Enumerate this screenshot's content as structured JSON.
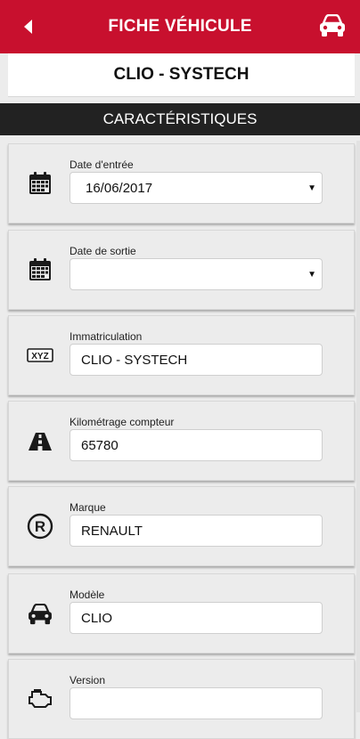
{
  "header": {
    "title": "FICHE VÉHICULE"
  },
  "vehicle_name": "CLIO - SYSTECH",
  "section_title": "CARACTÉRISTIQUES",
  "fields": {
    "date_entree": {
      "label": "Date d'entrée",
      "value": "16/06/2017",
      "icon": "calendar-icon"
    },
    "date_sortie": {
      "label": "Date de sortie",
      "value": "",
      "icon": "calendar-icon"
    },
    "immatriculation": {
      "label": "Immatriculation",
      "value": "CLIO - SYSTECH",
      "icon": "license-plate-icon",
      "icon_text": "XYZ"
    },
    "kilometrage": {
      "label": "Kilométrage compteur",
      "value": "65780",
      "icon": "road-icon"
    },
    "marque": {
      "label": "Marque",
      "value": "RENAULT",
      "icon": "registered-trademark-icon",
      "icon_text": "R"
    },
    "modele": {
      "label": "Modèle",
      "value": "CLIO",
      "icon": "car-icon"
    },
    "version": {
      "label": "Version",
      "value": "",
      "icon": "engine-icon"
    }
  },
  "colors": {
    "header_red": "#c8102e",
    "section_dark": "#222222",
    "card_bg": "#ececec"
  }
}
